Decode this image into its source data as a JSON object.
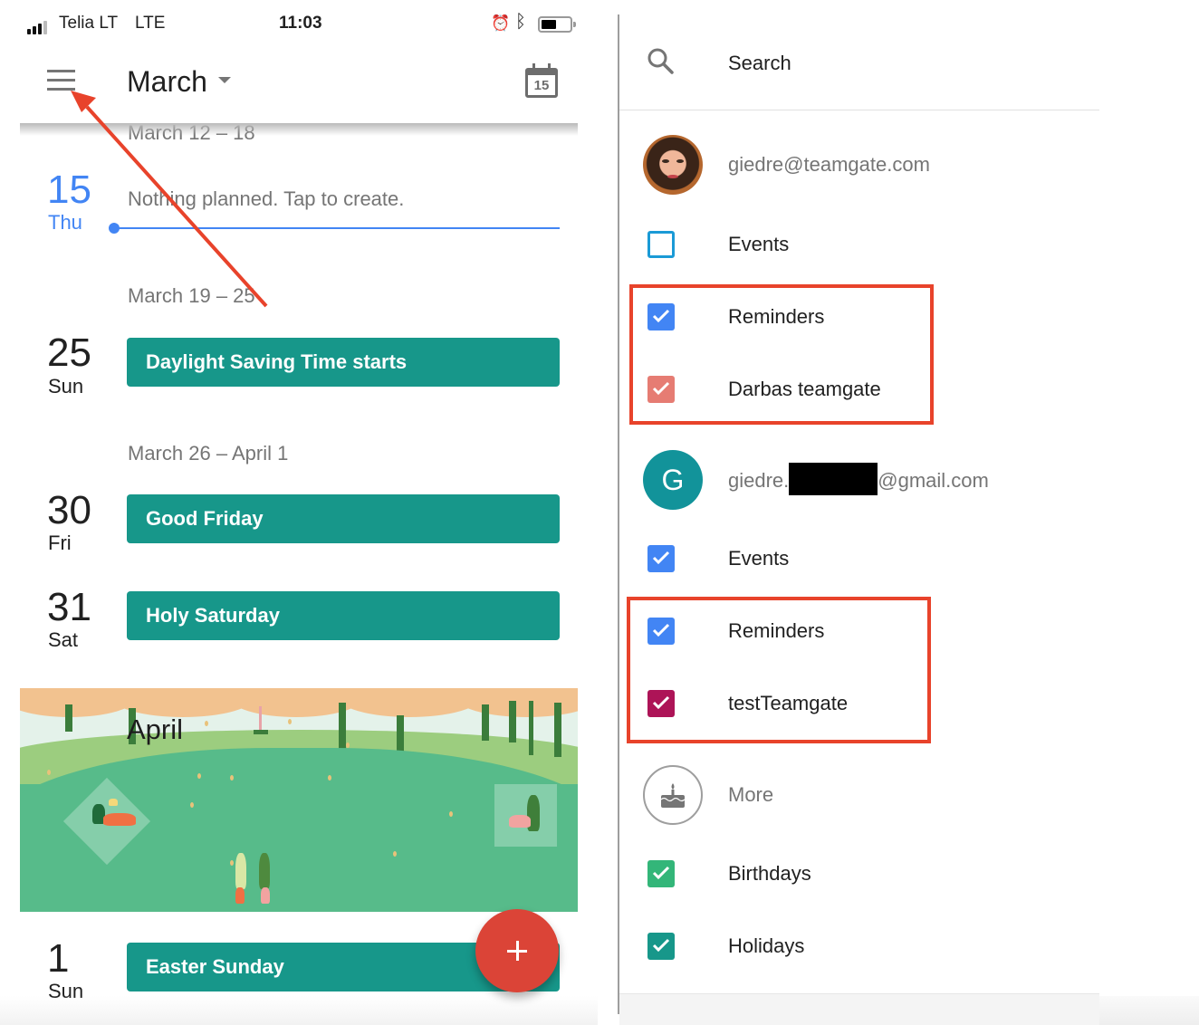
{
  "status_bar": {
    "carrier": "Telia LT",
    "network": "LTE",
    "time": "11:03",
    "icons": [
      "signal-icon",
      "alarm-icon",
      "bluetooth-icon",
      "battery-icon"
    ]
  },
  "app_bar": {
    "menu_icon": "hamburger-menu-icon",
    "month_title": "March",
    "dropdown_icon": "caret-down-icon",
    "today_icon": "calendar-today-icon",
    "today_number": "15"
  },
  "schedule": {
    "weeks": [
      {
        "label": "March 12 – 18"
      },
      {
        "label": "March 19 – 25"
      },
      {
        "label": "March 26 – April 1"
      }
    ],
    "days": [
      {
        "number": "15",
        "name": "Thu",
        "is_today": true,
        "empty_text": "Nothing planned. Tap to create."
      },
      {
        "number": "25",
        "name": "Sun",
        "event": "Daylight Saving Time starts"
      },
      {
        "number": "30",
        "name": "Fri",
        "event": "Good Friday"
      },
      {
        "number": "31",
        "name": "Sat",
        "event": "Holy Saturday"
      },
      {
        "number": "1",
        "name": "Sun",
        "event": "Easter Sunday"
      }
    ],
    "april_banner": {
      "label": "April"
    },
    "fab": {
      "icon": "plus-icon",
      "label": "+"
    }
  },
  "drawer": {
    "search": {
      "icon": "search-icon",
      "label": "Search"
    },
    "accounts": [
      {
        "email": "giedre@teamgate.com",
        "avatar": "profile-photo",
        "calendars": [
          {
            "label": "Events",
            "checked": false,
            "color": "#1a9ad6"
          },
          {
            "label": "Reminders",
            "checked": true,
            "color": "#4285f4"
          },
          {
            "label": "Darbas teamgate",
            "checked": true,
            "color": "#e67c73"
          }
        ]
      },
      {
        "email_prefix": "giedre.",
        "email_suffix": "@gmail.com",
        "avatar_letter": "G",
        "calendars": [
          {
            "label": "Events",
            "checked": true,
            "color": "#4285f4"
          },
          {
            "label": "Reminders",
            "checked": true,
            "color": "#4285f4"
          },
          {
            "label": "testTeamgate",
            "checked": true,
            "color": "#ad1457"
          }
        ]
      }
    ],
    "more": {
      "icon": "birthday-cake-icon",
      "label": "More",
      "calendars": [
        {
          "label": "Birthdays",
          "checked": true,
          "color": "#33b679"
        },
        {
          "label": "Holidays",
          "checked": true,
          "color": "#0b8043"
        }
      ]
    }
  },
  "annotations": {
    "highlight_color": "#e8432b",
    "arrow_color": "#e8432b"
  }
}
